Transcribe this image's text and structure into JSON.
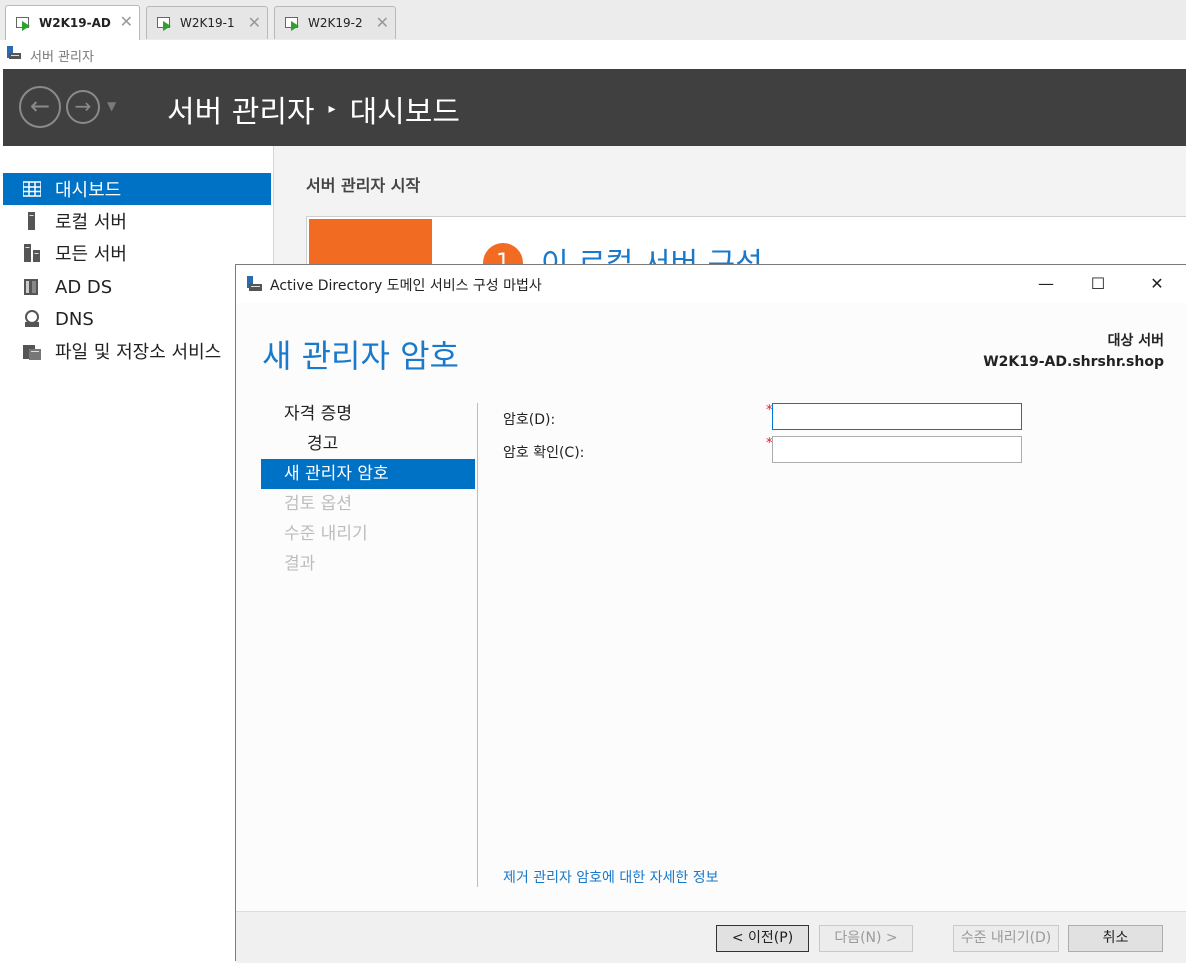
{
  "vm_tabs": [
    {
      "label": "W2K19-AD",
      "active": true
    },
    {
      "label": "W2K19-1",
      "active": false
    },
    {
      "label": "W2K19-2",
      "active": false
    }
  ],
  "app": {
    "title": "서버 관리자"
  },
  "header": {
    "root": "서버 관리자",
    "page": "대시보드"
  },
  "sidebar": {
    "items": [
      {
        "label": "대시보드",
        "icon": "dashboard-icon",
        "active": true
      },
      {
        "label": "로컬 서버",
        "icon": "local-server-icon"
      },
      {
        "label": "모든 서버",
        "icon": "all-servers-icon"
      },
      {
        "label": "AD DS",
        "icon": "ad-ds-icon"
      },
      {
        "label": "DNS",
        "icon": "dns-icon"
      },
      {
        "label": "파일 및 저장소 서비스",
        "icon": "file-storage-icon"
      }
    ]
  },
  "dashboard": {
    "section_title": "서버 관리자 시작",
    "step_number": "1",
    "step_text": "이 로컬 서버 구성"
  },
  "wizard": {
    "title": "Active Directory 도메인 서비스 구성 마법사",
    "heading": "새 관리자 암호",
    "target_label": "대상 서버",
    "target_server": "W2K19-AD.shrshr.shop",
    "steps": [
      {
        "label": "자격 증명",
        "state": "done"
      },
      {
        "label": "경고",
        "state": "done",
        "sub": true
      },
      {
        "label": "새 관리자 암호",
        "state": "active"
      },
      {
        "label": "검토 옵션",
        "state": "disabled"
      },
      {
        "label": "수준 내리기",
        "state": "disabled"
      },
      {
        "label": "결과",
        "state": "disabled"
      }
    ],
    "fields": {
      "password_label": "암호(D):",
      "password_value": "",
      "confirm_label": "암호 확인(C):",
      "confirm_value": "",
      "required_mark": "*"
    },
    "more_info_link": "제거 관리자 암호에 대한 자세한 정보",
    "buttons": {
      "prev": "< 이전(P)",
      "next": "다음(N) >",
      "demote": "수준 내리기(D)",
      "cancel": "취소"
    },
    "window_controls": {
      "minimize": "—",
      "maximize": "☐",
      "close": "✕"
    }
  },
  "colors": {
    "accent": "#0072c6",
    "header_bg": "#404040",
    "orange": "#f26b22",
    "heading_blue": "#1979ca"
  }
}
